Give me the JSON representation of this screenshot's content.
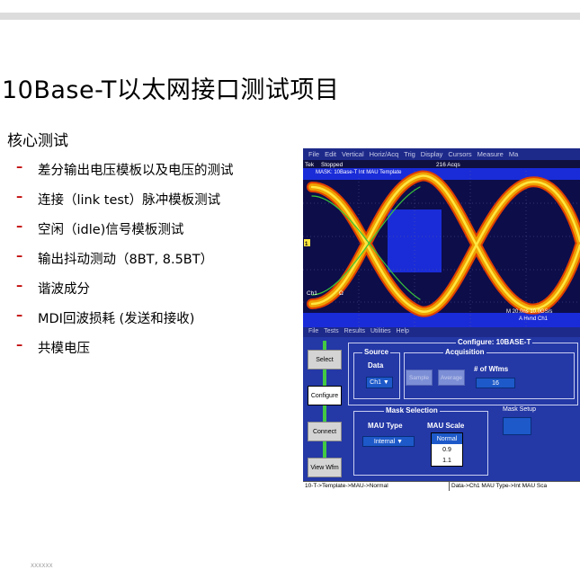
{
  "slide": {
    "title": "10Base-T以太网接口测试项目",
    "section": "核心测试",
    "bullets": [
      "差分输出电压模板以及电压的测试",
      "连接（link test）脉冲模板测试",
      "空闲（idle)信号模板测试",
      "输出抖动测动（8BT, 8.5BT）",
      "谐波成分",
      "MDI回波损耗 (发送和接收)",
      "共模电压"
    ],
    "footer": "XXXXXX"
  },
  "scope": {
    "menu": [
      "File",
      "Edit",
      "Vertical",
      "Horiz/Acq",
      "Trig",
      "Display",
      "Cursors",
      "Measure",
      "Ma"
    ],
    "status_left": "Tek",
    "status_state": "Stopped",
    "acq_count": "216 Acqs",
    "mask_label": "MASK: 10Base-T Int MAU Template",
    "ch_marker": "1",
    "ch_label": "Ch1",
    "ch_unit": "Ω",
    "timebase": "M 20.0ns 10.0GS/s",
    "trigger": "A Hvnd Ch1",
    "panel_menu": [
      "File",
      "Tests",
      "Results",
      "Utilities",
      "Help"
    ],
    "panel_title": "Configure: 10BASE-T",
    "side_buttons": [
      "Select",
      "Configure",
      "Connect",
      "View Wfm"
    ],
    "active_button": "Configure",
    "source": {
      "title": "Source",
      "label": "Data",
      "value": "Ch1 ▼"
    },
    "acquisition": {
      "title": "Acquisition",
      "sample": "Sample",
      "average": "Average",
      "wfms_label": "# of Wfms",
      "wfms_value": "16"
    },
    "mask_selection": {
      "title": "Mask Selection",
      "mau_type_label": "MAU Type",
      "mau_type_value": "Internal ▼",
      "mau_scale_label": "MAU Scale",
      "scale_options": [
        "Normal",
        "0.9",
        "1.1"
      ],
      "scale_selected": "Normal"
    },
    "mask_setup": "Mask Setup",
    "status_bar": [
      "10-T->Template->MAU->Normal",
      "Data->Ch1  MAU Type->Int  MAU Sca"
    ]
  },
  "colors": {
    "waveform": "#f0a000",
    "mask": "#1a2cd8",
    "panel": "#2438a6",
    "accent_red": "#c00000"
  }
}
